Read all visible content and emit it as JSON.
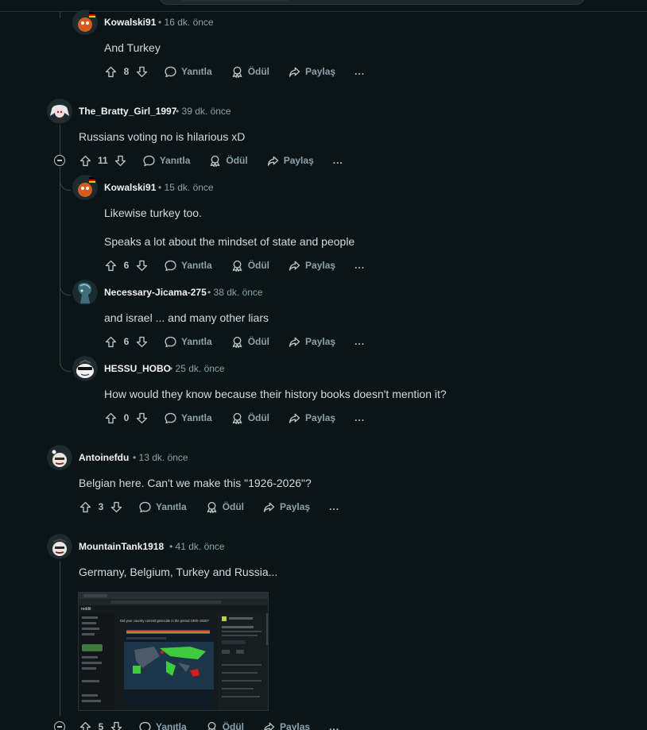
{
  "comments": [
    {
      "author": "Kowalski91",
      "time": "16 dk. önce",
      "lines": [
        "And Turkey"
      ],
      "votes": "8"
    },
    {
      "author": "The_Bratty_Girl_1997",
      "time": "39 dk. önce",
      "lines": [
        "Russians voting no is hilarious xD"
      ],
      "votes": "11"
    },
    {
      "author": "Kowalski91",
      "time": "15 dk. önce",
      "lines": [
        "Likewise turkey too.",
        "Speaks a lot about the mindset of state and people"
      ],
      "votes": "6"
    },
    {
      "author": "Necessary-Jicama-275",
      "time": "38 dk. önce",
      "lines": [
        "and israel ... and many other liars"
      ],
      "votes": "6"
    },
    {
      "author": "HESSU_HOBO",
      "time": "25 dk. önce",
      "lines": [
        "How would they know because their history books doesn't mention it?"
      ],
      "votes": "0"
    },
    {
      "author": "Antoinefdu",
      "time": "13 dk. önce",
      "lines": [
        "Belgian here. Can't we make this \"1926-2026\"?"
      ],
      "votes": "3"
    },
    {
      "author": "MountainTank1918",
      "time": "41 dk. önce",
      "lines": [
        "Germany, Belgium, Turkey and Russia..."
      ],
      "votes": "5"
    }
  ],
  "actions": {
    "reply": "Yanıtla",
    "award": "Ödül",
    "share": "Paylaş",
    "more": "..."
  },
  "separator": "•",
  "screenshot": {
    "site": "reddit",
    "headline": "Did your country commit genocide in the period 1900–2026?"
  },
  "colors": {
    "background": "#0b1416",
    "text": "#d7dadc",
    "meta": "#8ba2ad",
    "map_green": "#3ecc3e",
    "map_red": "#d81c1c"
  }
}
